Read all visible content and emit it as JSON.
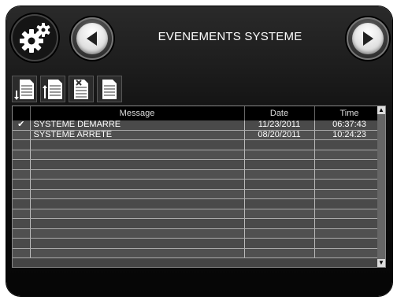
{
  "header": {
    "title": "EVENEMENTS SYSTEME"
  },
  "icons": {
    "settings": "gears-icon",
    "prev": "arrow-left-icon",
    "next": "arrow-right-icon",
    "toolbar": [
      "export-down-document-icon",
      "import-up-document-icon",
      "delete-document-icon",
      "document-icon"
    ]
  },
  "table": {
    "columns": [
      "",
      "Message",
      "Date",
      "Time"
    ],
    "rows": [
      {
        "checked": "✔",
        "message": "SYSTEME DEMARRE",
        "date": "11/23/2011",
        "time": "06:37:43"
      },
      {
        "checked": "",
        "message": "SYSTEME ARRETE",
        "date": "08/20/2011",
        "time": "10:24:23"
      },
      {
        "checked": "",
        "message": "",
        "date": "",
        "time": ""
      },
      {
        "checked": "",
        "message": "",
        "date": "",
        "time": ""
      },
      {
        "checked": "",
        "message": "",
        "date": "",
        "time": ""
      },
      {
        "checked": "",
        "message": "",
        "date": "",
        "time": ""
      },
      {
        "checked": "",
        "message": "",
        "date": "",
        "time": ""
      },
      {
        "checked": "",
        "message": "",
        "date": "",
        "time": ""
      },
      {
        "checked": "",
        "message": "",
        "date": "",
        "time": ""
      },
      {
        "checked": "",
        "message": "",
        "date": "",
        "time": ""
      },
      {
        "checked": "",
        "message": "",
        "date": "",
        "time": ""
      },
      {
        "checked": "",
        "message": "",
        "date": "",
        "time": ""
      },
      {
        "checked": "",
        "message": "",
        "date": "",
        "time": ""
      },
      {
        "checked": "",
        "message": "",
        "date": "",
        "time": ""
      }
    ]
  },
  "scrollbar": {
    "up": "▲",
    "down": "▼"
  },
  "colors": {
    "panel": "#111111",
    "row": "#4a4a4a",
    "header": "#000000",
    "accent": "#ffffff"
  }
}
